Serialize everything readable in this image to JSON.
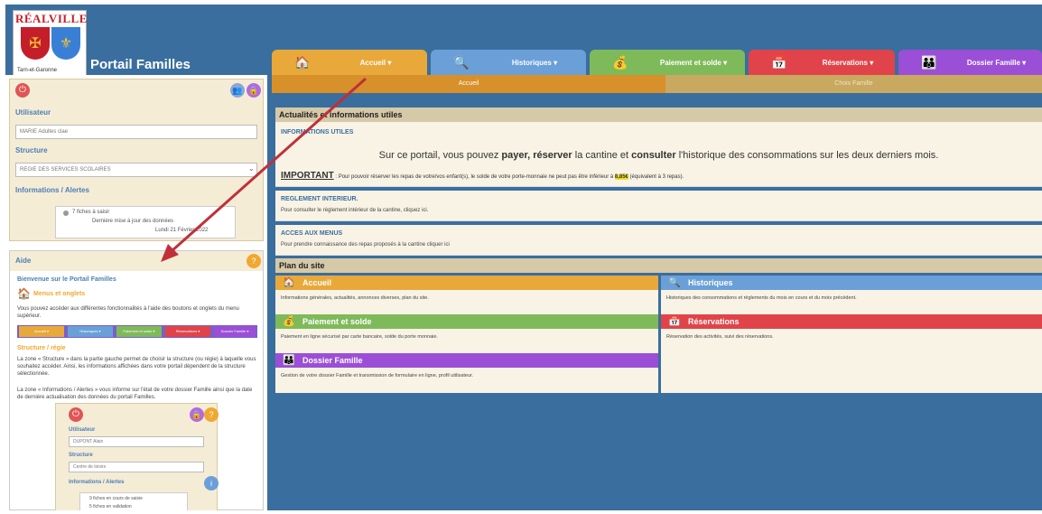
{
  "header": {
    "logo_title": "RÉALVILLE",
    "logo_subtitle": "Tarn-et-Garonne",
    "portal_title": "Portail Familles"
  },
  "tabs": [
    {
      "label": "Accueil ▾",
      "icon": "house-icon",
      "color": "#e8a93a"
    },
    {
      "label": "Historiques ▾",
      "icon": "history-icon",
      "color": "#6a9fd8"
    },
    {
      "label": "Paiement et solde ▾",
      "icon": "money-icon",
      "color": "#7fba5a"
    },
    {
      "label": "Réservations ▾",
      "icon": "calendar-icon",
      "color": "#e0444a"
    },
    {
      "label": "Dossier Famille ▾",
      "icon": "family-icon",
      "color": "#9b4fd6"
    }
  ],
  "subtabs": {
    "active": "Accueil",
    "inactive": "Choix Famille"
  },
  "left": {
    "user_label": "Utilisateur",
    "user_value": "MARIE Adultes clae",
    "structure_label": "Structure",
    "structure_value": "REGIE DES SERVICES SCOLAIRES",
    "alerts_label": "Informations / Alertes",
    "alerts_line1": "7 fiches à saisir",
    "alerts_line2": "Dernière mise à jour des données",
    "alerts_line3": "Lundi 21 Février 2022",
    "aide_title": "Aide",
    "aide_welcome": "Bienvenue sur le Portail Familles",
    "aide_menus_title": "Menus et onglets",
    "aide_menus_text": "Vous pouvez accéder aux différentes fonctionnalités à l'aide des boutons et onglets du menu supérieur.",
    "aide_structure_title": "Structure / régie",
    "aide_structure_text": "La zone « Structure » dans la partie gauche permet de choisir la structure (ou régie) à laquelle vous souhaitez accéder. Ainsi, les informations affichées dans votre portail dépendent de la structure sélectionnée.",
    "aide_alerts_text": "La zone « Informations / Alertes » vous informe sur l'état de votre dossier Famille ainsi que la date de dernière actualisation des données du portail Familles.",
    "mini": {
      "user_label": "Utilisateur",
      "user_value": "DUPONT Alain",
      "structure_label": "Structure",
      "structure_value": "Centre de loisirs",
      "alerts_label": "Informations / Alertes",
      "alerts_line1": "9 fiches en cours de saisie",
      "alerts_line2": "5 fiches en validation"
    }
  },
  "main": {
    "news_header": "Actualités et informations utiles",
    "info_link": "INFORMATIONS UTILES",
    "welcome_pre": "Sur ce portail, vous pouvez ",
    "welcome_bold1": "payer, réserver",
    "welcome_mid": " la cantine et ",
    "welcome_bold2": "consulter",
    "welcome_post": " l'historique des consommations sur les deux derniers mois.",
    "important_label": "IMPORTANT",
    "important_text": " : Pour pouvoir réserver les repas de votre/vos enfant(s), le solde de votre porte-monnaie ne peut pas être inférieur à ",
    "important_amount": "8,85€",
    "important_tail": " (équivalent à 3 repas).",
    "reglement_link": "REGLEMENT INTERIEUR.",
    "reglement_text": "Pour consulter le règlement intérieur de la cantine, cliquez ici.",
    "menus_link": "ACCES AUX MENUS",
    "menus_text": "Pour prendre connaissance des repas proposés à la cantine cliquer ici",
    "plan_header": "Plan du site",
    "cards": [
      {
        "title": "Accueil",
        "desc": "Informations générales, actualités, annonces diverses, plan du site.",
        "color": "#e8a93a"
      },
      {
        "title": "Historiques",
        "desc": "Historiques des consommations et règlements du mois en cours et du mois précédent.",
        "color": "#6a9fd8"
      },
      {
        "title": "Paiement et solde",
        "desc": "Paiement en ligne sécurisé par carte bancaire, solde du porte monnaie.",
        "color": "#7fba5a"
      },
      {
        "title": "Réservations",
        "desc": "Réservation des activités, suivi des réservations.",
        "color": "#e0444a"
      },
      {
        "title": "Dossier Famille",
        "desc": "Gestion de votre dossier Famille et transmission de formulaire en ligne, profil utilisateur.",
        "color": "#9b4fd6"
      }
    ]
  },
  "colors": {
    "page_bg": "#3a6e9e",
    "panel_bg": "#f5ecd6",
    "arrow": "#c0303a"
  }
}
